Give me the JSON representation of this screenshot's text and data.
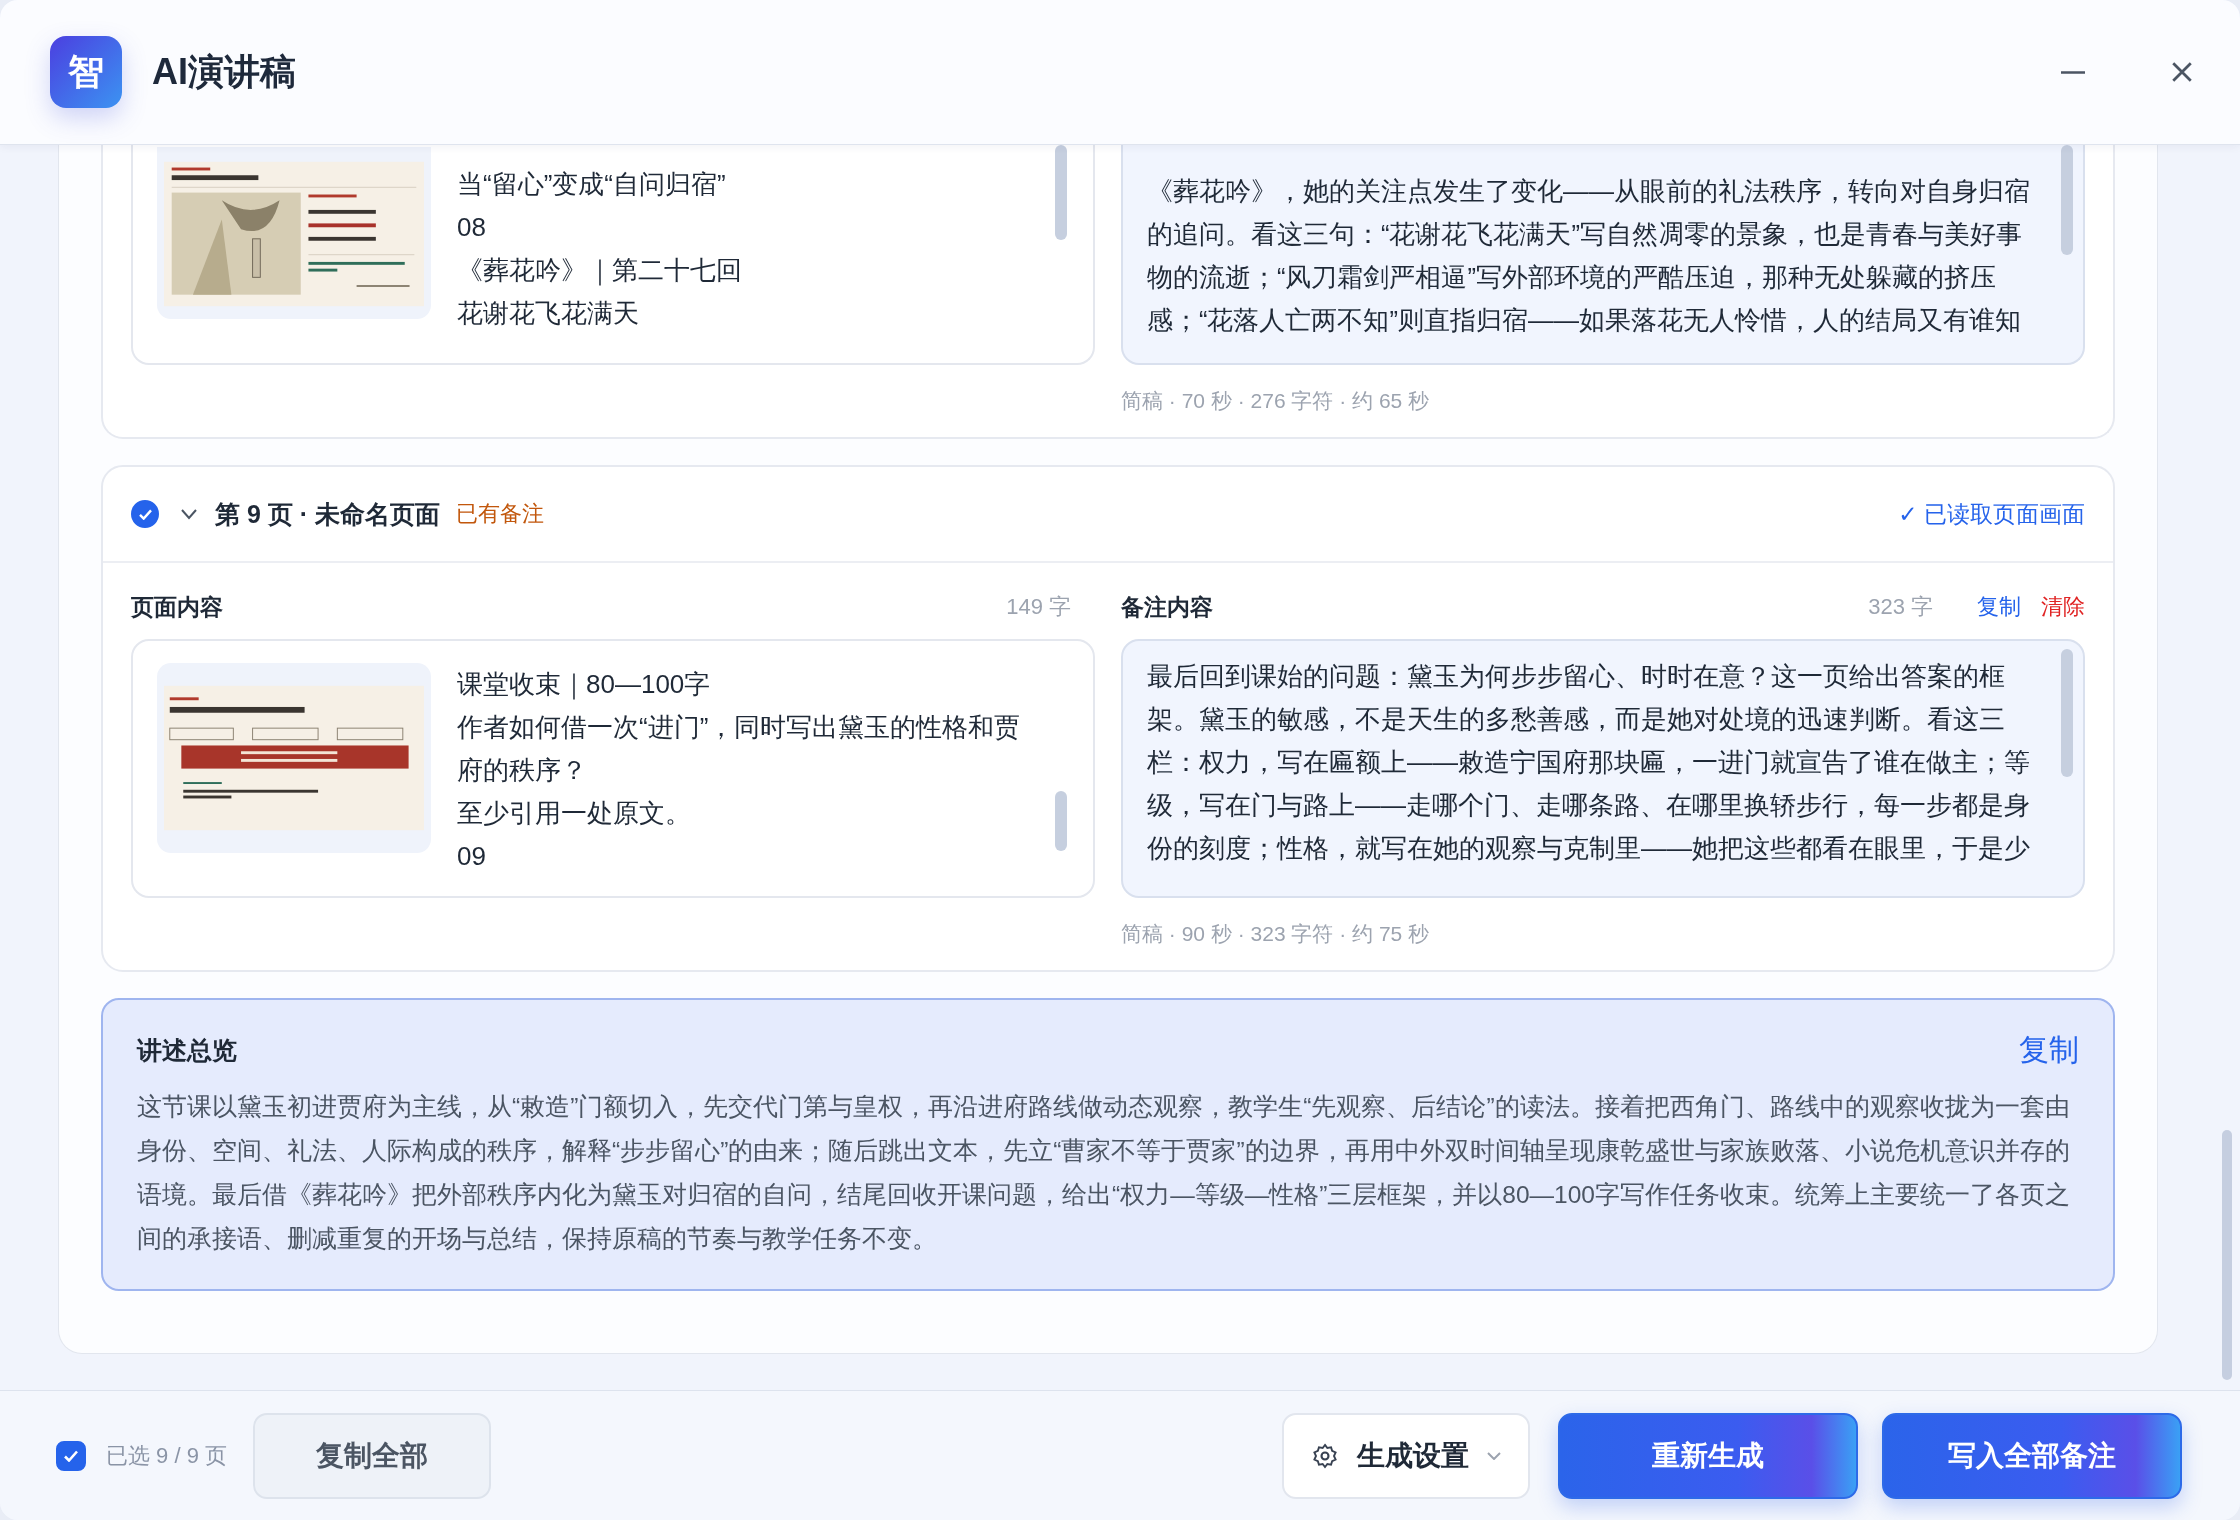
{
  "window": {
    "logo": "智",
    "title": "AI演讲稿"
  },
  "pages": [
    {
      "thumbnail": {
        "kind": "painting-slide"
      },
      "content_lines": [
        "当“留心”变成“自问归宿”",
        "08",
        "《葬花吟》｜第二十七回",
        "花谢花飞花满天"
      ],
      "notes_text": "《葬花吟》，她的关注点发生了变化——从眼前的礼法秩序，转向对自身归宿的追问。看这三句：“花谢花飞花满天”写自然凋零的景象，也是青春与美好事物的流逝；“风刀霜剑严相逼”写外部环境的严酷压迫，那种无处躲藏的挤压感；“花落人亡两不知”则直指归宿——如果落花无人怜惜，人的结局又有谁知",
      "meta": "简稿 · 70 秒 · 276 字符 · 约 65 秒"
    },
    {
      "checked": true,
      "expanded": true,
      "title": "第 9 页 · 未命名页面",
      "tag": "已有备注",
      "status": "✓ 已读取页面画面",
      "content_label": "页面内容",
      "content_count": "149 字",
      "notes_label": "备注内容",
      "notes_count": "323 字",
      "actions": [
        {
          "kind": "copy",
          "label": "复制"
        },
        {
          "kind": "clear",
          "label": "清除"
        }
      ],
      "thumbnail": {
        "kind": "table-slide"
      },
      "content_lines": [
        "课堂收束｜80—100字",
        "作者如何借一次“进门”，同时写出黛玉的性格和贾府的秩序？",
        "至少引用一处原文。",
        "09"
      ],
      "notes_text": "最后回到课始的问题：黛玉为何步步留心、时时在意？这一页给出答案的框架。黛玉的敏感，不是天生的多愁善感，而是她对处境的迅速判断。看这三栏：权力，写在匾额上——敕造宁国府那块匾，一进门就宣告了谁在做主；等级，写在门与路上——走哪个门、走哪条路、在哪里换轿步行，每一步都是身份的刻度；性格，就写在她的观察与克制里——她把这些都看在眼里，于是少",
      "meta": "简稿 · 90 秒 · 323 字符 · 约 75 秒"
    }
  ],
  "summary": {
    "title": "讲述总览",
    "copy": "复制",
    "text": "这节课以黛玉初进贾府为主线，从“敕造”门额切入，先交代门第与皇权，再沿进府路线做动态观察，教学生“先观察、后结论”的读法。接着把西角门、路线中的观察收拢为一套由身份、空间、礼法、人际构成的秩序，解释“步步留心”的由来；随后跳出文本，先立“曹家不等于贾家”的边界，再用中外双时间轴呈现康乾盛世与家族败落、小说危机意识并存的语境。最后借《葬花吟》把外部秩序内化为黛玉对归宿的自问，结尾回收开课问题，给出“权力—等级—性格”三层框架，并以80—100字写作任务收束。统筹上主要统一了各页之间的承接语、删减重复的开场与总结，保持原稿的节奏与教学任务不变。"
  },
  "footer": {
    "all_checked": true,
    "selection": "已选 9 / 9 页",
    "buttons": [
      {
        "kind": "secondary",
        "label": "复制全部"
      },
      {
        "kind": "settings",
        "label": "生成设置"
      },
      {
        "kind": "primary",
        "label": "重新生成"
      },
      {
        "kind": "primary",
        "label": "写入全部备注"
      }
    ]
  }
}
